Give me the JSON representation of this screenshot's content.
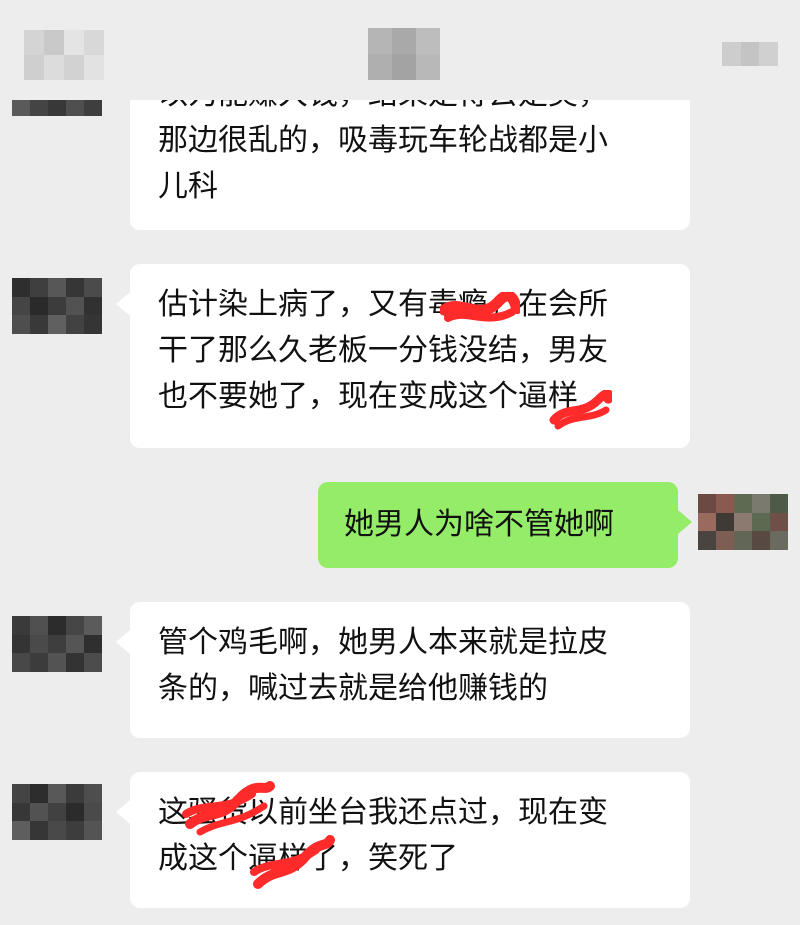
{
  "messages": [
    {
      "side": "left",
      "lines": [
        "以为能赚大钱，结果是得去是美，",
        "那边很乱的，吸毒玩车轮战都是小",
        "儿科"
      ]
    },
    {
      "side": "left",
      "lines": [
        "估计染上病了，又有毒瘾，在会所",
        "干了那么久老板一分钱没结，男友",
        "也不要她了，现在变成这个逼样"
      ]
    },
    {
      "side": "right",
      "lines": [
        "她男人为啥不管她啊"
      ]
    },
    {
      "side": "left",
      "lines": [
        "管个鸡毛啊，她男人本来就是拉皮",
        "条的，喊过去就是给他赚钱的"
      ]
    },
    {
      "side": "left",
      "lines": [
        "这骚货以前坐台我还点过，现在变",
        "成这个逼样了，笑死了"
      ]
    }
  ],
  "colors": {
    "background": "#ededed",
    "bubble_left": "#ffffff",
    "bubble_right": "#95ec69",
    "redaction_scribble": "#ff2a2a"
  },
  "icons": [
    "back-icon",
    "more-icon"
  ]
}
